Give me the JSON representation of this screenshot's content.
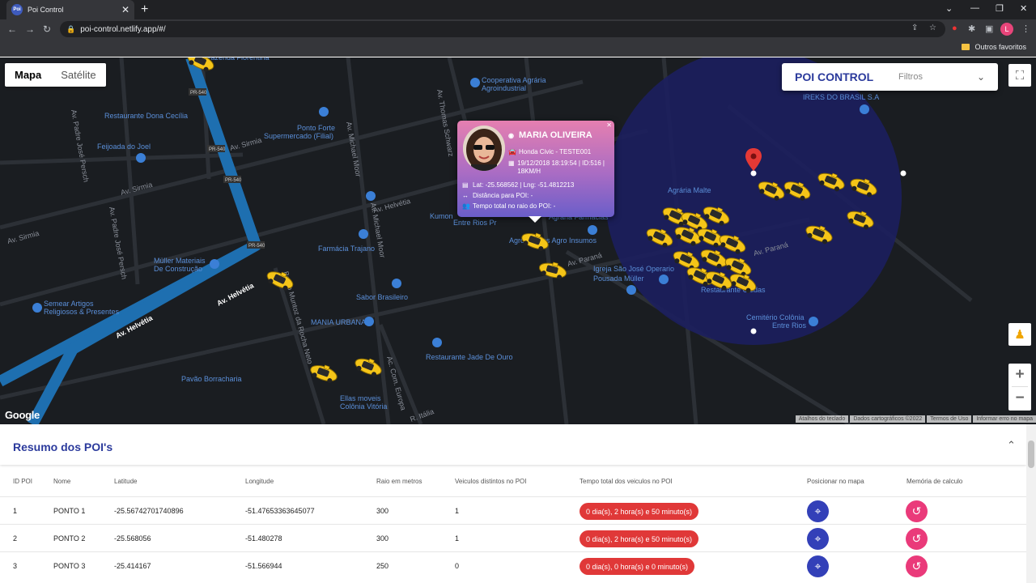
{
  "browser": {
    "tab_title": "Poi Control",
    "tab_favicon": "Poi",
    "url": "poi-control.netlify.app/#/",
    "bookmark": "Outros favoritos",
    "profile_initial": "L"
  },
  "map": {
    "type_buttons": [
      "Mapa",
      "Satélite"
    ],
    "active_type": "Mapa",
    "attribution": [
      "Atalhos do teclado",
      "Dados cartográficos ©2022",
      "Termos de Uso",
      "Informar erro no mapa"
    ],
    "places": [
      "Cooperativa Agrária Agroindustrial",
      "Restaurante Dona Cecília",
      "Ponto Forte Supermercado (Filial)",
      "Feijoada do Joel",
      "IREKS DO BRASIL S.A",
      "Agrária Malte",
      "Farmácia Trajano",
      "Müller Materiais De Construção",
      "Agrocampos Agro Insumos",
      "Igreja São José Operário",
      "Pousada Müller",
      "Restaurante Caldas",
      "Semear Artigos Religiosos & Presentes",
      "Sabor Brasileiro",
      "MANIA URBANA",
      "Cemitério Colônia Entre Rios",
      "Restaurante Jade De Ouro",
      "Pavão Borracharia",
      "Ellas moveis Colônia Vitória",
      "Kumon",
      "Agrária Farmácias",
      "Entre Rios Pr",
      "Fazenda Fiorentina"
    ],
    "streets": [
      "Av. Sirmia",
      "Av. Helvétia",
      "Av. Paraná",
      "Av. Thomas Schwarz",
      "Av. Michael Moor",
      "Av. Padre José Persch",
      "Bento Muntoz da Rocha Neto",
      "Ac. Com. Europa",
      "R. Itália",
      "PR-540"
    ]
  },
  "poi_panel": {
    "brand": "POI CONTROL",
    "filters_label": "Filtros"
  },
  "popup": {
    "name": "MARIA OLIVEIRA",
    "vehicle": "Honda Civic - TESTE001",
    "timestamp": "19/12/2018 18:19:54 | ID:516 | 18KM/H",
    "coords": "Lat: -25.568562 | Lng: -51.4812213",
    "distance": "Distância para POI: -",
    "total_time": "Tempo total no raio do POI: -"
  },
  "summary": {
    "title": "Resumo dos POI's",
    "columns": [
      "ID POI",
      "Nome",
      "Latitude",
      "Longitude",
      "Raio em metros",
      "Veiculos distintos no POI",
      "Tempo total dos veiculos no POI",
      "Posicionar no mapa",
      "Memória de calculo"
    ],
    "rows": [
      {
        "id": "1",
        "name": "PONTO 1",
        "lat": "-25.56742701740896",
        "lng": "-51.47653363645077",
        "radius": "300",
        "vehicles": "1",
        "time": "0 dia(s), 2 hora(s) e 50 minuto(s)"
      },
      {
        "id": "2",
        "name": "PONTO 2",
        "lat": "-25.568056",
        "lng": "-51.480278",
        "radius": "300",
        "vehicles": "1",
        "time": "0 dia(s), 2 hora(s) e 50 minuto(s)"
      },
      {
        "id": "3",
        "name": "PONTO 3",
        "lat": "-25.414167",
        "lng": "-51.566944",
        "radius": "250",
        "vehicles": "0",
        "time": "0 dia(s), 0 hora(s) e 0 minuto(s)"
      }
    ]
  },
  "colors": {
    "map_bg": "#1a1d21",
    "road_highlight": "#1e6fb0",
    "poi_circle": "#1c1f5e",
    "brand": "#2b3a9c",
    "pill_red": "#e03838",
    "btn_blue": "#3340b8",
    "btn_pink": "#ea3a7a",
    "taxi": "#f5c518"
  }
}
